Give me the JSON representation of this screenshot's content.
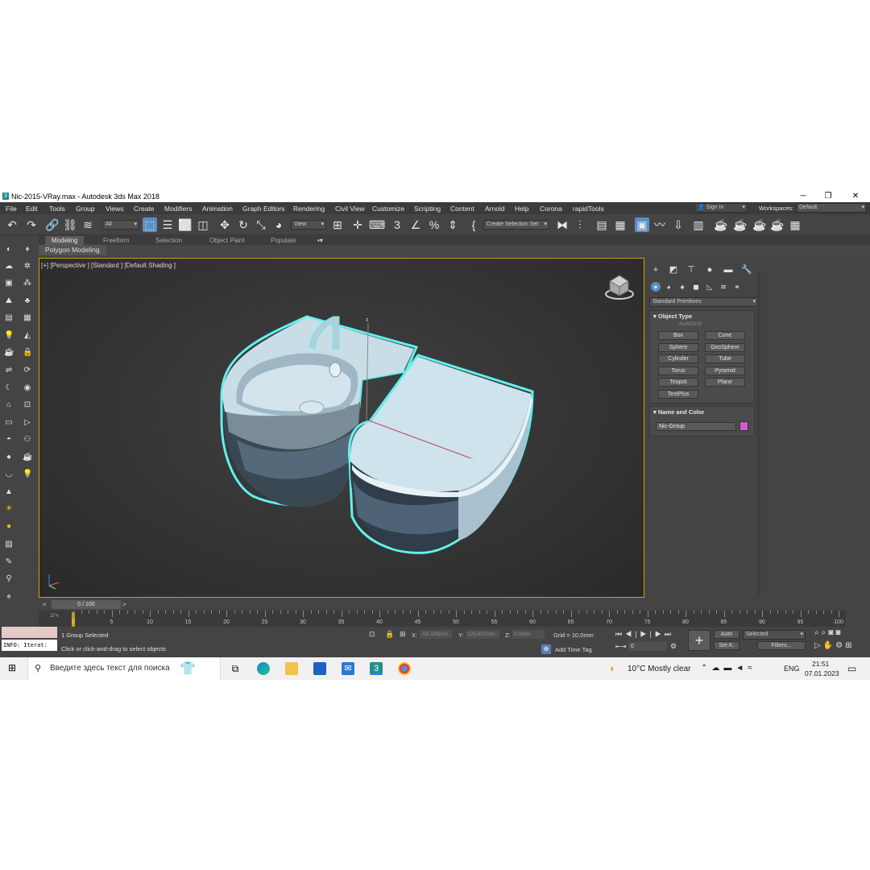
{
  "window": {
    "title": "Nic-2015-VRay.max - Autodesk 3ds Max 2018",
    "logo": "3"
  },
  "menu": [
    "File",
    "Edit",
    "Tools",
    "Group",
    "Views",
    "Create",
    "Modifiers",
    "Animation",
    "Graph Editors",
    "Rendering",
    "Civil View",
    "Customize",
    "Scripting",
    "Content",
    "Arnold",
    "Help",
    "Corona",
    "rapidTools"
  ],
  "account": {
    "sign_in": "Sign In",
    "workspaces_label": "Workspaces:",
    "workspace": "Default"
  },
  "toolbar": {
    "filter": "All",
    "view": "View",
    "selection_set": "Create Selection Set"
  },
  "ribbon": {
    "tabs": [
      "Modeling",
      "Freeform",
      "Selection",
      "Object Paint",
      "Populate"
    ],
    "active": "Modeling",
    "panel": "Polygon Modeling"
  },
  "viewport": {
    "label": "[+] [Perspective ] [Standard ] [Default Shading ]",
    "axis_x": "x",
    "axis_z": "z"
  },
  "command_panel": {
    "category": "Standard Primitives",
    "object_type_title": "Object Type",
    "autogrid": "AutoGrid",
    "buttons": [
      "Box",
      "Cone",
      "Sphere",
      "GeoSphere",
      "Cylinder",
      "Tube",
      "Torus",
      "Pyramid",
      "Teapot",
      "Plane",
      "TextPlus"
    ],
    "name_color_title": "Name and Color",
    "object_name": "Nic-Group",
    "object_color": "#d45ad2"
  },
  "timeline": {
    "frame": "0 / 100",
    "ticks": [
      "0",
      "5",
      "10",
      "15",
      "20",
      "25",
      "30",
      "35",
      "40",
      "45",
      "50",
      "55",
      "60",
      "65",
      "70",
      "75",
      "80",
      "85",
      "90",
      "95",
      "100"
    ]
  },
  "status": {
    "maxscript": "INFO: Iterat:",
    "selected": "1 Group Selected",
    "prompt": "Click or click-and-drag to select objects",
    "x_label": "X:",
    "x": "-50,125mm",
    "y_label": "Y:",
    "y": "125,637mm",
    "z_label": "Z:",
    "z": "0,0mm",
    "grid": "Grid = 10,0mm",
    "add_time_tag": "Add Time Tag",
    "auto": "Auto",
    "set_key": "Set K.",
    "key_mode": "Selected",
    "filters": "Filters...",
    "frame_spinner": "0"
  },
  "taskbar": {
    "search_placeholder": "Введите здесь текст для поиска",
    "weather": "10°C  Mostly clear",
    "lang": "ENG",
    "time": "21:51",
    "date": "07.01.2023"
  }
}
